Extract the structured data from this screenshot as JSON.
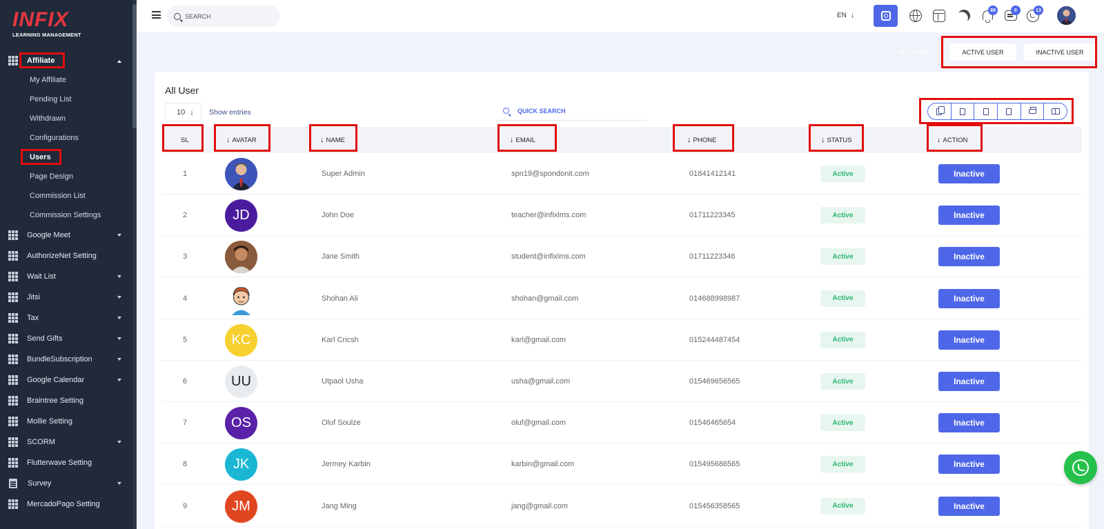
{
  "brand": {
    "logo": "INFIX",
    "tagline": "LEARNING MANAGEMENT"
  },
  "sidebar": {
    "open_menu": {
      "label": "Affiliate",
      "icon": "grid-icon"
    },
    "submenu": [
      {
        "label": "My Affiliate"
      },
      {
        "label": "Pending List"
      },
      {
        "label": "Withdrawn"
      },
      {
        "label": "Configurations"
      },
      {
        "label": "Users",
        "active": true
      },
      {
        "label": "Page Design"
      },
      {
        "label": "Commission List"
      },
      {
        "label": "Commission Settings"
      }
    ],
    "items": [
      {
        "label": "Google Meet",
        "dropdown": true,
        "icon": "grid-icon"
      },
      {
        "label": "AuthorizeNet Setting",
        "dropdown": false,
        "icon": "grid-icon"
      },
      {
        "label": "Wait List",
        "dropdown": true,
        "icon": "grid-icon"
      },
      {
        "label": "Jitsi",
        "dropdown": true,
        "icon": "grid-icon"
      },
      {
        "label": "Tax",
        "dropdown": true,
        "icon": "grid-icon"
      },
      {
        "label": "Send Gifts",
        "dropdown": true,
        "icon": "grid-icon"
      },
      {
        "label": "BundleSubscription",
        "dropdown": true,
        "icon": "grid-icon"
      },
      {
        "label": "Google Calendar",
        "dropdown": true,
        "icon": "grid-icon"
      },
      {
        "label": "Braintree Setting",
        "dropdown": false,
        "icon": "grid-icon"
      },
      {
        "label": "Mollie Setting",
        "dropdown": false,
        "icon": "grid-icon"
      },
      {
        "label": "SCORM",
        "dropdown": true,
        "icon": "grid-icon"
      },
      {
        "label": "Flutterwave Setting",
        "dropdown": false,
        "icon": "grid-icon"
      },
      {
        "label": "Survey",
        "dropdown": true,
        "icon": "doc-icon"
      },
      {
        "label": "MercadoPago Setting",
        "dropdown": false,
        "icon": "grid-icon"
      }
    ]
  },
  "topbar": {
    "search_placeholder": "SEARCH",
    "language": "EN",
    "badges": {
      "notifications": "69",
      "messages": "0",
      "whatsapp": "13"
    }
  },
  "filters": {
    "all_user": "ALL USER",
    "active_user": "ACTIVE USER",
    "inactive_user": "INACTIVE USER"
  },
  "card": {
    "title": "All User",
    "entries_value": "10",
    "show_entries": "Show entries",
    "quick_search_placeholder": "QUICK SEARCH",
    "export_buttons": [
      "copy-icon",
      "csv-icon",
      "excel-icon",
      "pdf-icon",
      "print-icon",
      "columns-icon"
    ]
  },
  "table": {
    "columns": {
      "sl": "SL",
      "avatar": "AVATAR",
      "name": "NAME",
      "email": "EMAIL",
      "phone": "PHONE",
      "status": "STATUS",
      "action": "ACTION"
    },
    "rows": [
      {
        "sl": "1",
        "avatar_type": "photo",
        "avatar_color": "#3d55b8",
        "initials": "",
        "name": "Super Admin",
        "email": "spn19@spondonit.com",
        "phone": "01841412141",
        "status": "Active",
        "action": "Inactive"
      },
      {
        "sl": "2",
        "avatar_type": "initials",
        "avatar_color": "#4b1b9e",
        "initials": "JD",
        "name": "John Doe",
        "email": "teacher@infixlms.com",
        "phone": "01711223345",
        "status": "Active",
        "action": "Inactive"
      },
      {
        "sl": "3",
        "avatar_type": "photo",
        "avatar_color": "#8a5a3c",
        "initials": "",
        "name": "Jane Smith",
        "email": "student@infixlms.com",
        "phone": "01711223346",
        "status": "Active",
        "action": "Inactive"
      },
      {
        "sl": "4",
        "avatar_type": "cartoon",
        "avatar_color": "#ffffff",
        "initials": "",
        "name": "Shohan Ali",
        "email": "shohan@gmail.com",
        "phone": "014688998987",
        "status": "Active",
        "action": "Inactive"
      },
      {
        "sl": "5",
        "avatar_type": "initials",
        "avatar_color": "#f6d02f",
        "initials": "KC",
        "name": "Karl Cricsh",
        "email": "karl@gmail.com",
        "phone": "015244487454",
        "status": "Active",
        "action": "Inactive"
      },
      {
        "sl": "6",
        "avatar_type": "initials",
        "avatar_color": "#e9ecef",
        "initials": "UU",
        "name": "Utpaol Usha",
        "email": "usha@gmail.com",
        "phone": "015469656565",
        "status": "Active",
        "action": "Inactive"
      },
      {
        "sl": "7",
        "avatar_type": "initials",
        "avatar_color": "#5a22a8",
        "initials": "OS",
        "name": "Oluf Soulze",
        "email": "oluf@gmail.com",
        "phone": "01546465654",
        "status": "Active",
        "action": "Inactive"
      },
      {
        "sl": "8",
        "avatar_type": "initials",
        "avatar_color": "#19b7d4",
        "initials": "JK",
        "name": "Jermey Karbin",
        "email": "karbin@gmail.com",
        "phone": "015495686565",
        "status": "Active",
        "action": "Inactive"
      },
      {
        "sl": "9",
        "avatar_type": "initials",
        "avatar_color": "#e0461f",
        "initials": "JM",
        "name": "Jang Ming",
        "email": "jang@gmail.com",
        "phone": "015456358565",
        "status": "Active",
        "action": "Inactive"
      }
    ]
  },
  "colors": {
    "accent": "#4e67e8",
    "sidebar": "#202a3b",
    "highlight": "#e20d0d",
    "active_status": "#2bb673",
    "whatsapp": "#26c14a"
  }
}
